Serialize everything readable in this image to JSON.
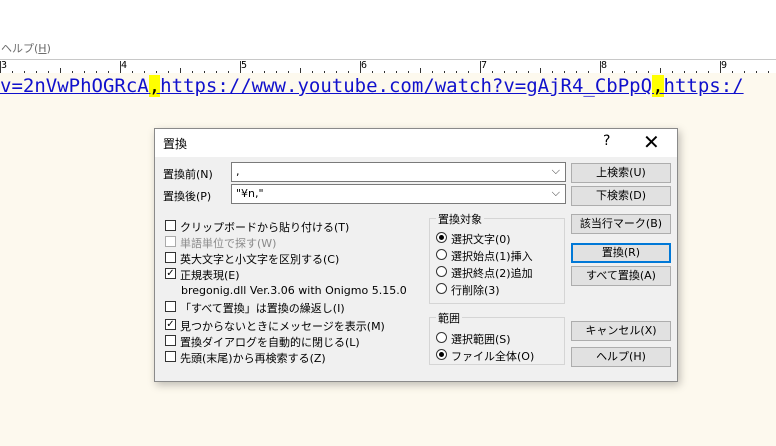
{
  "menu": {
    "help_prefix": "ヘルプ(",
    "help_key": "H",
    "help_suffix": ")"
  },
  "ruler": {
    "marks": [
      "3",
      "4",
      "5",
      "6",
      "7",
      "8",
      "9"
    ]
  },
  "editor": {
    "seg1": "v=2nVwPhOGRcA",
    "comma1": ",",
    "seg2": "https://www.youtube.com/watch?v=gAjR4_CbPpQ",
    "comma2": ",",
    "seg3": "https:/"
  },
  "dialog": {
    "title": "置換",
    "help_glyph": "?",
    "close_glyph": "✕",
    "find_label": "置換前(N)",
    "find_value": ",",
    "replace_label": "置換後(P)",
    "replace_value": "\"¥n,\"",
    "buttons": {
      "search_up": "上検索(U)",
      "search_down": "下検索(D)",
      "mark": "該当行マーク(B)",
      "replace": "置換(R)",
      "replace_all": "すべて置換(A)",
      "cancel": "キャンセル(X)",
      "help": "ヘルプ(H)"
    },
    "options": {
      "paste_clipboard": "クリップボードから貼り付ける(T)",
      "word_search": "単語単位で探す(W)",
      "case_sensitive": "英大文字と小文字を区別する(C)",
      "regex": "正規表現(E)",
      "regex_info": "bregonig.dll Ver.3.06 with Onigmo 5.15.0",
      "repeat_replace_all": "「すべて置換」は置換の繰返し(I)",
      "show_message": "見つからないときにメッセージを表示(M)",
      "auto_close": "置換ダイアログを自動的に閉じる(L)",
      "wrap_search": "先頭(末尾)から再検索する(Z)"
    },
    "target_group": {
      "title": "置換対象",
      "items": [
        "選択文字(0)",
        "選択始点(1)挿入",
        "選択終点(2)追加",
        "行削除(3)"
      ]
    },
    "range_group": {
      "title": "範囲",
      "items": [
        "選択範囲(S)",
        "ファイル全体(O)"
      ]
    }
  }
}
